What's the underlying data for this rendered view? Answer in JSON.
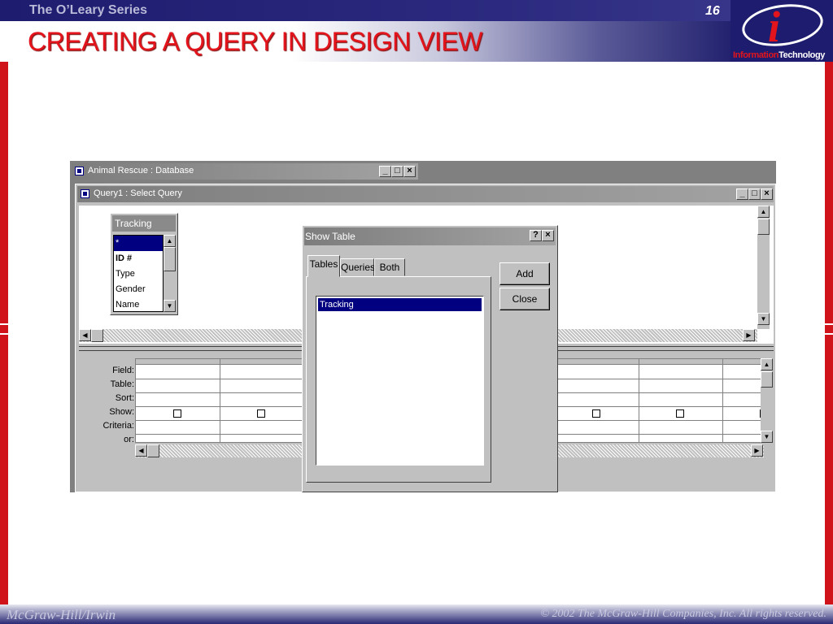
{
  "slide": {
    "series": "The O’Leary Series",
    "page_number": "16",
    "title": "CREATING A QUERY IN DESIGN VIEW",
    "logo": {
      "part1": "Information",
      "part2": "Technology"
    },
    "footer_left": "McGraw-Hill/Irwin",
    "footer_right": "© 2002  The McGraw-Hill Companies, Inc. All rights reserved."
  },
  "database_window": {
    "title": "Animal Rescue : Database"
  },
  "query_window": {
    "title": "Query1 : Select Query",
    "field_list": {
      "title": "Tracking",
      "items": [
        "*",
        "ID #",
        "Type",
        "Gender",
        "Name"
      ],
      "selected_index": 0,
      "bold_index": 1
    },
    "grid": {
      "row_labels": [
        "Field:",
        "Table:",
        "Sort:",
        "Show:",
        "Criteria:",
        "or:"
      ],
      "visible_columns": 7
    }
  },
  "show_table_dialog": {
    "title": "Show Table",
    "help_button": "?",
    "close_button": "×",
    "tabs": [
      "Tables",
      "Queries",
      "Both"
    ],
    "active_tab": "Tables",
    "list_items": [
      "Tracking"
    ],
    "add_button": "Add",
    "close_label": "Close"
  },
  "colors": {
    "slide_red": "#e3141b",
    "navy": "#1e1c6e",
    "selection": "#000080",
    "window_face": "#c0c0c0"
  }
}
